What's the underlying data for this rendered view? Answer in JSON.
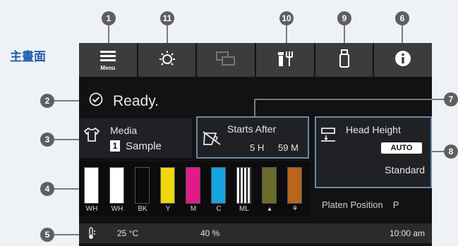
{
  "page_title": "主畫面",
  "callouts": {
    "menu": "1",
    "brightness": "11",
    "maintenance": "10",
    "usb": "9",
    "info": "6",
    "status": "2",
    "media": "3",
    "ink": "4",
    "footer": "5",
    "starts_after": "7",
    "head_height": "8"
  },
  "tabs": [
    {
      "label": "Menu",
      "icon": "hamburger-icon"
    },
    {
      "label": "",
      "icon": "brightness-icon"
    },
    {
      "label": "",
      "icon": "windows-icon"
    },
    {
      "label": "",
      "icon": "maintenance-icon"
    },
    {
      "label": "",
      "icon": "usb-icon"
    },
    {
      "label": "",
      "icon": "info-icon"
    }
  ],
  "status": {
    "text": "Ready.",
    "icon": "check-circle-icon"
  },
  "media": {
    "title": "Media",
    "number": "1",
    "name": "Sample",
    "icon": "tshirt-icon"
  },
  "starts_after": {
    "title": "Starts After",
    "hours": "5 H",
    "minutes": "59 M",
    "icon": "timer-off-icon"
  },
  "head_height": {
    "title": "Head Height",
    "mode": "AUTO",
    "value": "Standard",
    "icon": "head-icon"
  },
  "platen": {
    "label": "Platen Position",
    "value": "P"
  },
  "inks": [
    {
      "label": "WH",
      "color": "#ffffff",
      "level": 1.0
    },
    {
      "label": "WH",
      "color": "#ffffff",
      "level": 1.0
    },
    {
      "label": "BK",
      "color": "#0a0a0a",
      "level": 1.0
    },
    {
      "label": "Y",
      "color": "#f0d80a",
      "level": 1.0
    },
    {
      "label": "M",
      "color": "#e2198a",
      "level": 1.0
    },
    {
      "label": "C",
      "color": "#15a4de",
      "level": 1.0
    },
    {
      "label": "ML",
      "color": "#ffffff",
      "level": 1.0
    },
    {
      "label": "",
      "color": "#6a6a2a",
      "level": 1.0,
      "icon": "waste-ink-icon"
    },
    {
      "label": "",
      "color": "#b8641c",
      "level": 1.0,
      "icon": "cleaning-icon"
    }
  ],
  "footer": {
    "temperature": "25 °C",
    "humidity": "40 %",
    "time": "10:00 am"
  }
}
